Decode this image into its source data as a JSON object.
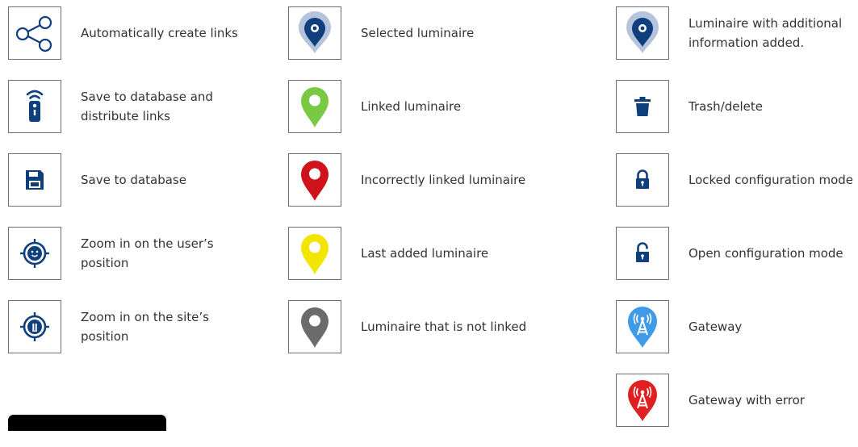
{
  "colors": {
    "brand_blue": "#0f3f7c",
    "selected_halo": "#b5c3dd",
    "linked_green": "#7ac943",
    "error_red": "#d0121b",
    "last_added_yellow": "#f2e600",
    "not_linked_gray": "#6b6b6b",
    "gateway_blue": "#3f9ae8",
    "gateway_red": "#e02020",
    "box_border": "#6f6f6f"
  },
  "legend": {
    "column_1": [
      {
        "icon": "share-links-icon",
        "label": "Automatically create links"
      },
      {
        "icon": "remote-distribute-icon",
        "label": "Save to database and distribute links"
      },
      {
        "icon": "floppy-disk-icon",
        "label": "Save to database"
      },
      {
        "icon": "user-position-target-icon",
        "label": "Zoom in on the user’s position"
      },
      {
        "icon": "site-position-target-icon",
        "label": "Zoom in on the site’s position"
      }
    ],
    "column_2": [
      {
        "icon": "selected-pin-icon",
        "label": "Selected luminaire"
      },
      {
        "icon": "green-pin-icon",
        "label": "Linked luminaire"
      },
      {
        "icon": "red-pin-icon",
        "label": "Incorrectly linked luminaire"
      },
      {
        "icon": "yellow-pin-icon",
        "label": "Last added luminaire"
      },
      {
        "icon": "gray-pin-icon",
        "label": "Luminaire that is not linked"
      }
    ],
    "column_3": [
      {
        "icon": "info-pin-icon",
        "label": "Luminaire with additional information added."
      },
      {
        "icon": "trash-icon",
        "label": "Trash/delete"
      },
      {
        "icon": "locked-padlock-icon",
        "label": "Locked configuration mode"
      },
      {
        "icon": "open-padlock-icon",
        "label": "Open configuration mode"
      },
      {
        "icon": "gateway-icon",
        "label": "Gateway"
      },
      {
        "icon": "gateway-error-icon",
        "label": "Gateway with error"
      }
    ]
  }
}
